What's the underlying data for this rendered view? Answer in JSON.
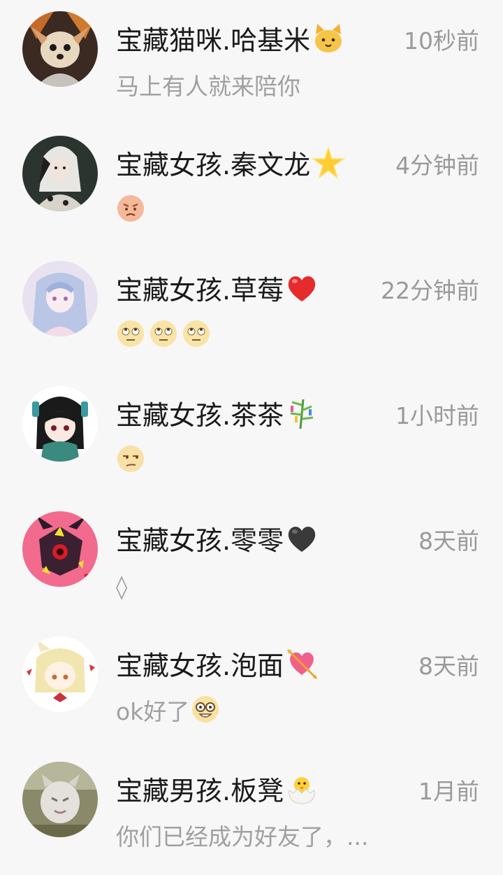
{
  "chats": [
    {
      "name": "宝藏猫咪.哈基米",
      "name_emoji": "cat-face-emoji",
      "time": "10秒前",
      "preview": "马上有人就来陪你",
      "avatar": "chihuahua-avatar"
    },
    {
      "name": "宝藏女孩.秦文龙",
      "name_emoji": "glowing-star-emoji",
      "time": "4分钟前",
      "preview": "",
      "preview_emojis": [
        "angry-face-emoji"
      ],
      "avatar": "goth-girl-avatar"
    },
    {
      "name": "宝藏女孩.草莓",
      "name_emoji": "red-heart-emoji",
      "time": "22分钟前",
      "preview": "",
      "preview_emojis": [
        "rolling-eyes-emoji",
        "rolling-eyes-emoji",
        "rolling-eyes-emoji"
      ],
      "avatar": "anime-blue-hair-avatar"
    },
    {
      "name": "宝藏女孩.茶茶",
      "name_emoji": "tanabata-tree-emoji",
      "time": "1小时前",
      "preview": "",
      "preview_emojis": [
        "unamused-face-emoji"
      ],
      "avatar": "anime-green-hair-avatar"
    },
    {
      "name": "宝藏女孩.零零",
      "name_emoji": "black-heart-emoji",
      "time": "8天前",
      "preview": "◊",
      "avatar": "pink-monster-avatar"
    },
    {
      "name": "宝藏女孩.泡面",
      "name_emoji": "heart-with-arrow-emoji",
      "time": "8天前",
      "preview": "ok好了",
      "preview_emojis_after": [
        "nerd-face-emoji"
      ],
      "avatar": "anime-blonde-avatar"
    },
    {
      "name": "宝藏男孩.板凳",
      "name_emoji": "hatching-chick-emoji",
      "time": "1月前",
      "preview": "你们已经成为好友了，...",
      "avatar": "blurry-cat-avatar"
    }
  ],
  "colors": {
    "background": "#f7f7f7",
    "name_text": "#1a1a1a",
    "secondary_text": "#9a9a9a"
  }
}
